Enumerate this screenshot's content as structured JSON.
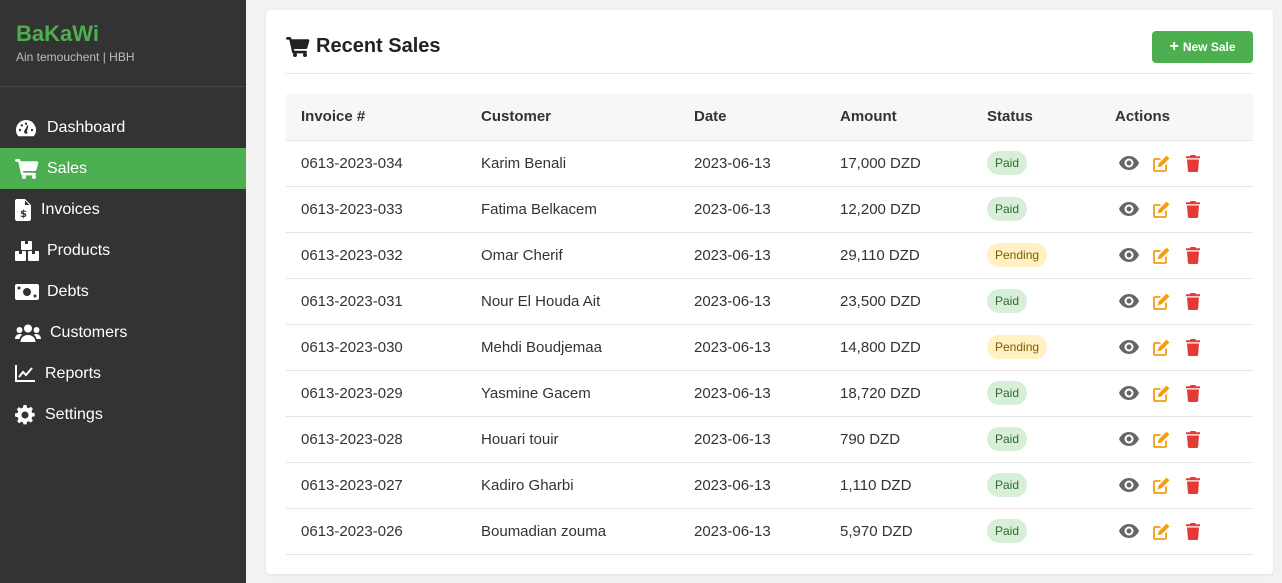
{
  "brand": {
    "name": "BaKaWi",
    "subtitle": "Ain temouchent | HBH"
  },
  "nav": [
    {
      "label": "Dashboard",
      "icon": "gauge-icon",
      "active": false
    },
    {
      "label": "Sales",
      "icon": "cart-icon",
      "active": true
    },
    {
      "label": "Invoices",
      "icon": "invoice-icon",
      "active": false
    },
    {
      "label": "Products",
      "icon": "boxes-icon",
      "active": false
    },
    {
      "label": "Debts",
      "icon": "money-bill-icon",
      "active": false
    },
    {
      "label": "Customers",
      "icon": "users-icon",
      "active": false
    },
    {
      "label": "Reports",
      "icon": "chart-line-icon",
      "active": false
    },
    {
      "label": "Settings",
      "icon": "gear-icon",
      "active": false
    }
  ],
  "header": {
    "title": "Recent Sales",
    "new_button": "New Sale"
  },
  "table": {
    "columns": [
      "Invoice #",
      "Customer",
      "Date",
      "Amount",
      "Status",
      "Actions"
    ],
    "rows": [
      {
        "invoice": "0613-2023-034",
        "customer": "Karim Benali",
        "date": "2023-06-13",
        "amount": "17,000 DZD",
        "status": "Paid"
      },
      {
        "invoice": "0613-2023-033",
        "customer": "Fatima Belkacem",
        "date": "2023-06-13",
        "amount": "12,200 DZD",
        "status": "Paid"
      },
      {
        "invoice": "0613-2023-032",
        "customer": "Omar Cherif",
        "date": "2023-06-13",
        "amount": "29,110 DZD",
        "status": "Pending"
      },
      {
        "invoice": "0613-2023-031",
        "customer": "Nour El Houda Ait",
        "date": "2023-06-13",
        "amount": "23,500 DZD",
        "status": "Paid"
      },
      {
        "invoice": "0613-2023-030",
        "customer": "Mehdi Boudjemaa",
        "date": "2023-06-13",
        "amount": "14,800 DZD",
        "status": "Pending"
      },
      {
        "invoice": "0613-2023-029",
        "customer": "Yasmine Gacem",
        "date": "2023-06-13",
        "amount": "18,720 DZD",
        "status": "Paid"
      },
      {
        "invoice": "0613-2023-028",
        "customer": "Houari touir",
        "date": "2023-06-13",
        "amount": "790 DZD",
        "status": "Paid"
      },
      {
        "invoice": "0613-2023-027",
        "customer": "Kadiro Gharbi",
        "date": "2023-06-13",
        "amount": "1,110 DZD",
        "status": "Paid"
      },
      {
        "invoice": "0613-2023-026",
        "customer": "Boumadian zouma",
        "date": "2023-06-13",
        "amount": "5,970 DZD",
        "status": "Paid"
      }
    ]
  },
  "colors": {
    "accent": "#4caf50",
    "sidebar": "#333333",
    "edit": "#f39c12",
    "delete": "#e53935",
    "view": "#666666"
  }
}
